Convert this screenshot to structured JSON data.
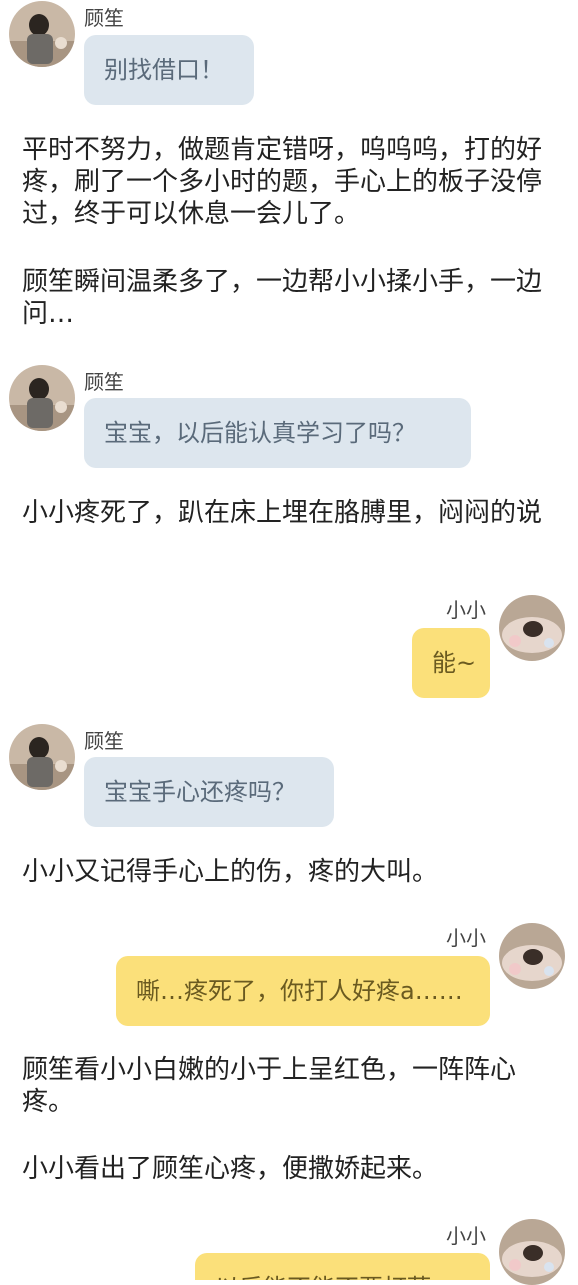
{
  "messages": [
    {
      "sender": "顾笙",
      "text": "别找借口！"
    },
    {
      "sender": "顾笙",
      "text": "宝宝，以后能认真学习了吗？"
    },
    {
      "sender": "小小",
      "text": "能~"
    },
    {
      "sender": "顾笙",
      "text": "宝宝手心还疼吗？"
    },
    {
      "sender": "小小",
      "text": "嘶…疼死了，你打人好疼a……"
    },
    {
      "sender": "小小",
      "text": "以后能不能不要打藕"
    }
  ],
  "narration": [
    "平时不努力，做题肯定错呀，呜呜呜，打的好疼，刷了一个多小时的题，手心上的板子没停过，终于可以休息一会儿了。",
    "顾笙瞬间温柔多了，一边帮小小揉小手，一边问…",
    "小小疼死了，趴在床上埋在胳膊里，闷闷的说",
    "小小又记得手心上的伤，疼的大叫。",
    "顾笙看小小白嫩的小于上呈红色，一阵阵心疼。",
    "小小看出了顾笙心疼，便撒娇起来。"
  ],
  "colors": {
    "left_bubble": "#dde6ee",
    "right_bubble": "#fbe07a"
  }
}
